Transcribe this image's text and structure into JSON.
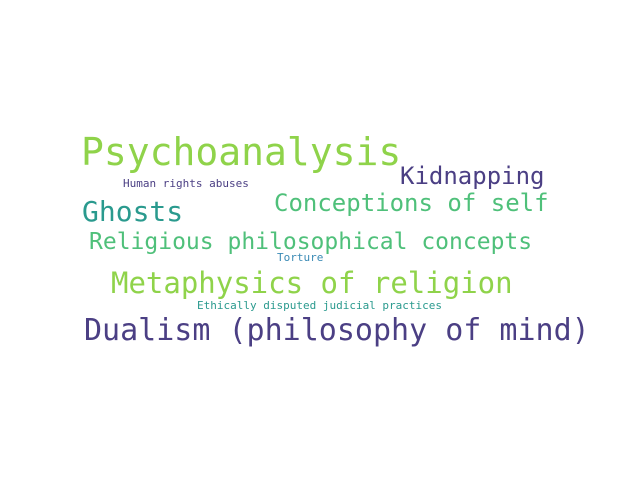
{
  "word_cloud": {
    "words": [
      {
        "text": "Psychoanalysis",
        "color": "#8fd34a"
      },
      {
        "text": "Kidnapping",
        "color": "#4b3f84"
      },
      {
        "text": "Human rights abuses",
        "color": "#4b3f84"
      },
      {
        "text": "Conceptions of self",
        "color": "#4fc07a"
      },
      {
        "text": "Ghosts",
        "color": "#2a9a8e"
      },
      {
        "text": "Religious philosophical concepts",
        "color": "#4fc07a"
      },
      {
        "text": "Torture",
        "color": "#3a8ab5"
      },
      {
        "text": "Metaphysics of religion",
        "color": "#8fd34a"
      },
      {
        "text": "Ethically disputed judicial practices",
        "color": "#2a9a8e"
      },
      {
        "text": "Dualism (philosophy of mind)",
        "color": "#4b3f84"
      }
    ]
  }
}
